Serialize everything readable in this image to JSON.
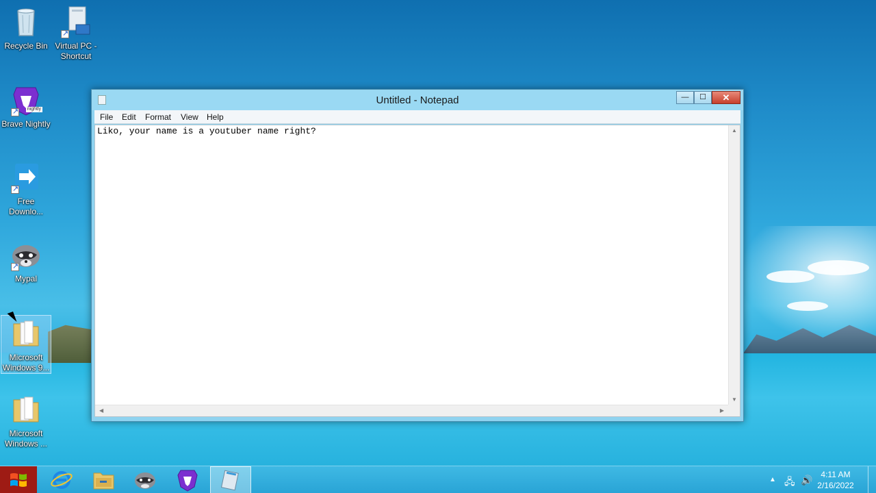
{
  "desktop": {
    "icons": [
      {
        "label": "Recycle Bin",
        "icon": "recycle-bin-icon"
      },
      {
        "label": "Virtual PC -\nShortcut",
        "icon": "virtual-pc-icon"
      },
      {
        "label": "Brave Nightly",
        "icon": "brave-nightly-icon",
        "badge": "nightly"
      },
      {
        "label": "Free\nDownlo...",
        "icon": "free-download-manager-icon"
      },
      {
        "label": "Mypal",
        "icon": "mypal-raccoon-icon"
      },
      {
        "label": "Microsoft\nWindows 9...",
        "icon": "folder-icon"
      },
      {
        "label": "Microsoft\nWindows ...",
        "icon": "folder-icon"
      }
    ]
  },
  "notepad": {
    "title": "Untitled - Notepad",
    "menu": [
      "File",
      "Edit",
      "Format",
      "View",
      "Help"
    ],
    "content": "Liko, your name is a youtuber name right?",
    "buttons": {
      "minimize": "—",
      "maximize": "☐",
      "close": "✕"
    }
  },
  "taskbar": {
    "apps": [
      {
        "name": "internet-explorer-icon",
        "active": false
      },
      {
        "name": "file-explorer-icon",
        "active": false
      },
      {
        "name": "mypal-raccoon-icon",
        "active": false
      },
      {
        "name": "brave-nightly-icon",
        "active": false
      },
      {
        "name": "notepad-icon",
        "active": true
      }
    ],
    "clock": {
      "time": "4:11 AM",
      "date": "2/16/2022"
    }
  },
  "colors": {
    "taskbar": "#29a4d6",
    "start": "#9e1b14",
    "window_frame": "#9ad9f3",
    "close_button": "#c7402c"
  }
}
